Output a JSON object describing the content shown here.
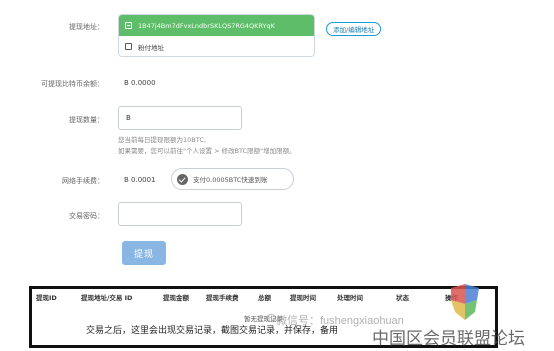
{
  "withdraw_address": {
    "label": "提现地址：",
    "selected": "1B47j4Bm7dFvxLndbrSKLQS7RG4QKRYqK",
    "other": "粉付地址",
    "manage_button": "添加/编辑地址"
  },
  "balance": {
    "label": "可提现比特币余额：",
    "value": "B 0.0000"
  },
  "amount": {
    "label": "提现数量：",
    "value": "B",
    "hint_line1": "您当前每日提现限额为10BTC,",
    "hint_line2_prefix": "如果需要，您可以前往\"个人设置 > 修改BTC限额\"增加限额。",
    "hint_link": "个人设置 > 修改BTC限额"
  },
  "fee": {
    "label": "网络手续费：",
    "value": "B 0.0001",
    "fast_option": "支付0.0005BTC快速到账"
  },
  "password": {
    "label": "交易密码：",
    "value": ""
  },
  "submit_label": "提现",
  "table": {
    "headers": [
      "提现ID",
      "提现地址/交易 ID",
      "提现金额",
      "提现手续费",
      "总额",
      "提现时间",
      "处理时间",
      "状态",
      "操作"
    ],
    "empty_text": "暂无提现记录",
    "note": "交易之后，这里会出现交易记录，截图交易记录，并保存，备用"
  },
  "watermark": {
    "wechat": "微信号：fushengxiaohuan",
    "forum": "中国区会员联盟论坛"
  }
}
